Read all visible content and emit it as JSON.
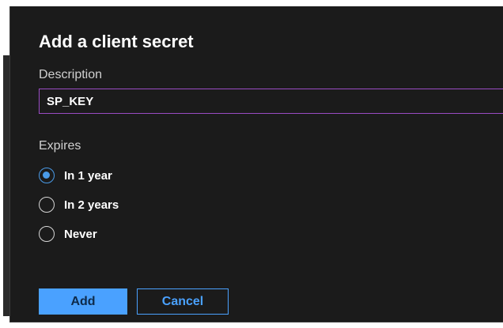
{
  "dialog": {
    "title": "Add a client secret",
    "description": {
      "label": "Description",
      "value": "SP_KEY"
    },
    "expires": {
      "label": "Expires",
      "options": [
        {
          "label": "In 1 year",
          "selected": true
        },
        {
          "label": "In 2 years",
          "selected": false
        },
        {
          "label": "Never",
          "selected": false
        }
      ]
    },
    "buttons": {
      "add_label": "Add",
      "cancel_label": "Cancel"
    }
  },
  "colors": {
    "panel_bg": "#1b1b1b",
    "input_border_focus": "#9a4cc4",
    "accent": "#4aa1ff",
    "radio_selected": "#4a9be8"
  }
}
